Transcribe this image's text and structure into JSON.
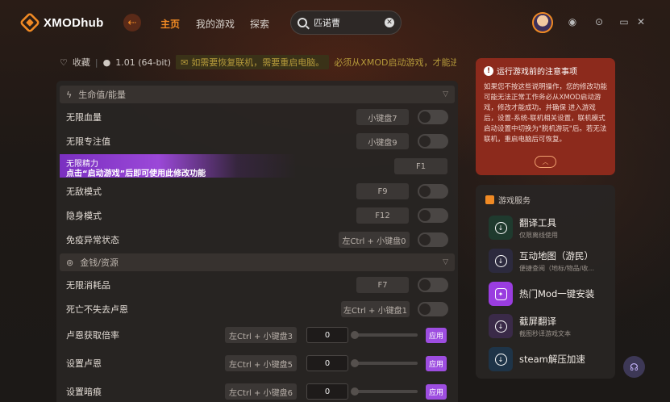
{
  "app": {
    "name": "XMODhub"
  },
  "nav": {
    "back_icon": "arrow-left-icon",
    "home": "主页",
    "my_games": "我的游戏",
    "explore": "探索"
  },
  "search": {
    "value": "匹诺曹"
  },
  "window": {
    "controls": [
      "settings-icon",
      "minimize-icon",
      "close-icon"
    ]
  },
  "info": {
    "favorite": "收藏",
    "version": "1.01 (64-bit)",
    "notice": "如需要恢复联机，需要重启电脑。",
    "notice2": "必须从XMOD启动游戏，才能进行"
  },
  "sections": {
    "health": "生命值/能量",
    "money": "金钱/资源"
  },
  "mods": [
    {
      "label": "无限血量",
      "key": "小键盘7"
    },
    {
      "label": "无限专注值",
      "key": "小键盘9"
    },
    {
      "label": "无限精力",
      "key": "F1",
      "tip": "点击“启动游戏”后即可使用此修改功能"
    },
    {
      "label": "无敌模式",
      "key": "F9"
    },
    {
      "label": "隐身模式",
      "key": "F12"
    },
    {
      "label": "免疫异常状态",
      "key": "左Ctrl + 小键盘0"
    },
    {
      "label": "无限消耗品",
      "key": "F7"
    },
    {
      "label": "死亡不失去卢恩",
      "key": "左Ctrl + 小键盘1"
    }
  ],
  "value_mods": [
    {
      "label": "卢恩获取倍率",
      "key": "左Ctrl + 小键盘3",
      "value": "0",
      "apply": "应用"
    },
    {
      "label": "设置卢恩",
      "key": "左Ctrl + 小键盘5",
      "value": "0",
      "apply": "应用"
    },
    {
      "label": "设置暗痕",
      "key": "左Ctrl + 小键盘6",
      "value": "0",
      "apply": "应用"
    }
  ],
  "warning": {
    "title": "运行游戏前的注意事项",
    "body": "如果您不按这些说明操作，您的修改功能可能无法正常工作务必从XMOD启动游戏，修改才能成功。并确保 进入游戏后，设置-系统-联机相关设置，联机模式启动设置中切换为\"脱机游玩\"后。若无法联机，重启电脑后可恢复。"
  },
  "services": {
    "title": "游戏服务",
    "items": [
      {
        "title": "翻译工具",
        "sub": "仅限离线使用",
        "color": "#1f3a2e"
      },
      {
        "title": "互动地图（游民）",
        "sub": "便捷查阅（地标/物品/收...",
        "color": "#2c2a3e"
      },
      {
        "title": "热门Mod一键安装",
        "sub": "",
        "color": "#9a3de0"
      },
      {
        "title": "截屏翻译",
        "sub": "截图秒译游戏文本",
        "color": "#3a2a48"
      },
      {
        "title": "steam解压加速",
        "sub": "",
        "color": "#1e3448"
      }
    ]
  },
  "colors": {
    "accent": "#f08a24",
    "purple": "#9d4de0",
    "warning_bg": "#8c2a1c"
  }
}
